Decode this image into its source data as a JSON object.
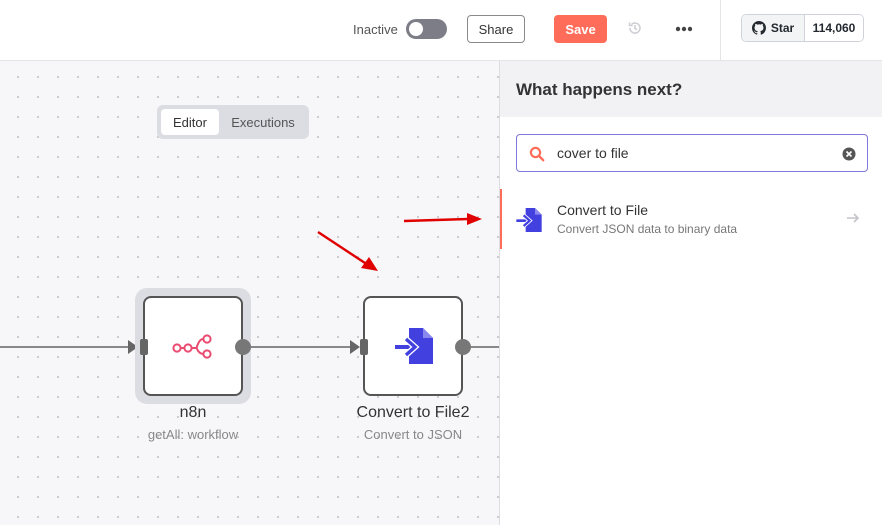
{
  "header": {
    "active_label": "Inactive",
    "share_label": "Share",
    "save_label": "Save",
    "github": {
      "star_label": "Star",
      "star_count": "114,060"
    }
  },
  "canvas": {
    "tabs": [
      {
        "label": "Editor",
        "active": true
      },
      {
        "label": "Executions",
        "active": false
      }
    ],
    "nodes": [
      {
        "title": "n8n",
        "subtitle": "getAll: workflow",
        "icon": "n8n-logo-icon",
        "selected": true
      },
      {
        "title": "Convert to File2",
        "subtitle": "Convert to JSON",
        "icon": "convert-to-file-icon",
        "selected": false
      }
    ]
  },
  "panel": {
    "title": "What happens next?",
    "search": {
      "value": "cover to file",
      "placeholder": "Search nodes..."
    },
    "results": [
      {
        "title": "Convert to File",
        "description": "Convert JSON data to binary data",
        "icon": "convert-to-file-icon"
      }
    ]
  },
  "colors": {
    "accent": "#ff6d5a",
    "search_border": "#7e77e0",
    "node_icon": "#4340e0",
    "n8n_icon": "#ea4b71",
    "annotation_arrow": "#e00000"
  }
}
